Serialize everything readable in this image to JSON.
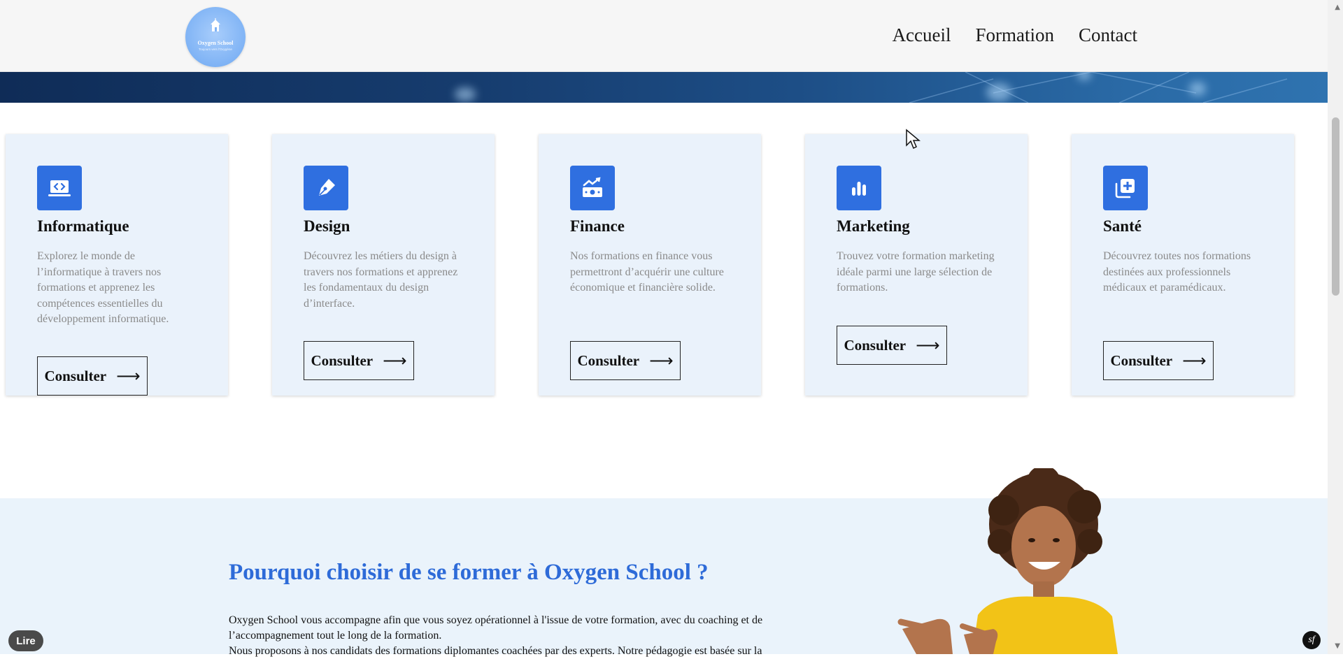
{
  "header": {
    "logo_title": "Oxygen School",
    "logo_subtitle": "Toujours vers l'Oxygène",
    "nav": [
      "Accueil",
      "Formation",
      "Contact"
    ]
  },
  "cards": [
    {
      "icon": "code-laptop-icon",
      "title": "Informatique",
      "description": "Explorez le monde de l’informatique à travers nos formations et apprenez les compétences essentielles du développement informatique.",
      "button": "Consulter"
    },
    {
      "icon": "pen-nib-icon",
      "title": "Design",
      "description": "Découvrez les métiers du design à travers nos formations et apprenez les fondamentaux du design d’interface.",
      "button": "Consulter"
    },
    {
      "icon": "money-growth-icon",
      "title": "Finance",
      "description": "Nos formations en finance vous permettront d’acquérir une culture économique et financière solide.",
      "button": "Consulter"
    },
    {
      "icon": "bar-chart-icon",
      "title": "Marketing",
      "description": "Trouvez votre formation marketing idéale parmi une large sélection de formations.",
      "button": "Consulter"
    },
    {
      "icon": "medical-plus-icon",
      "title": "Santé",
      "description": "Découvrez toutes nos formations destinées aux professionnels médicaux et paramédicaux.",
      "button": "Consulter"
    }
  ],
  "why": {
    "heading": "Pourquoi choisir de se former à Oxygen School ?",
    "paragraph1": "Oxygen School vous accompagne afin que vous soyez opérationnel à l'issue de votre formation, avec du coaching et de l’accompagnement tout le long de la formation.",
    "paragraph2": "Nous proposons à nos candidats des formations diplomantes coachées par des experts. Notre pédagogie est basée sur la"
  },
  "overlays": {
    "read_button": "Lire",
    "sf_badge": "sf"
  },
  "colors": {
    "accent": "#2f6fe0",
    "heading_blue": "#2e6bd8",
    "card_bg": "#eaf2fb"
  }
}
